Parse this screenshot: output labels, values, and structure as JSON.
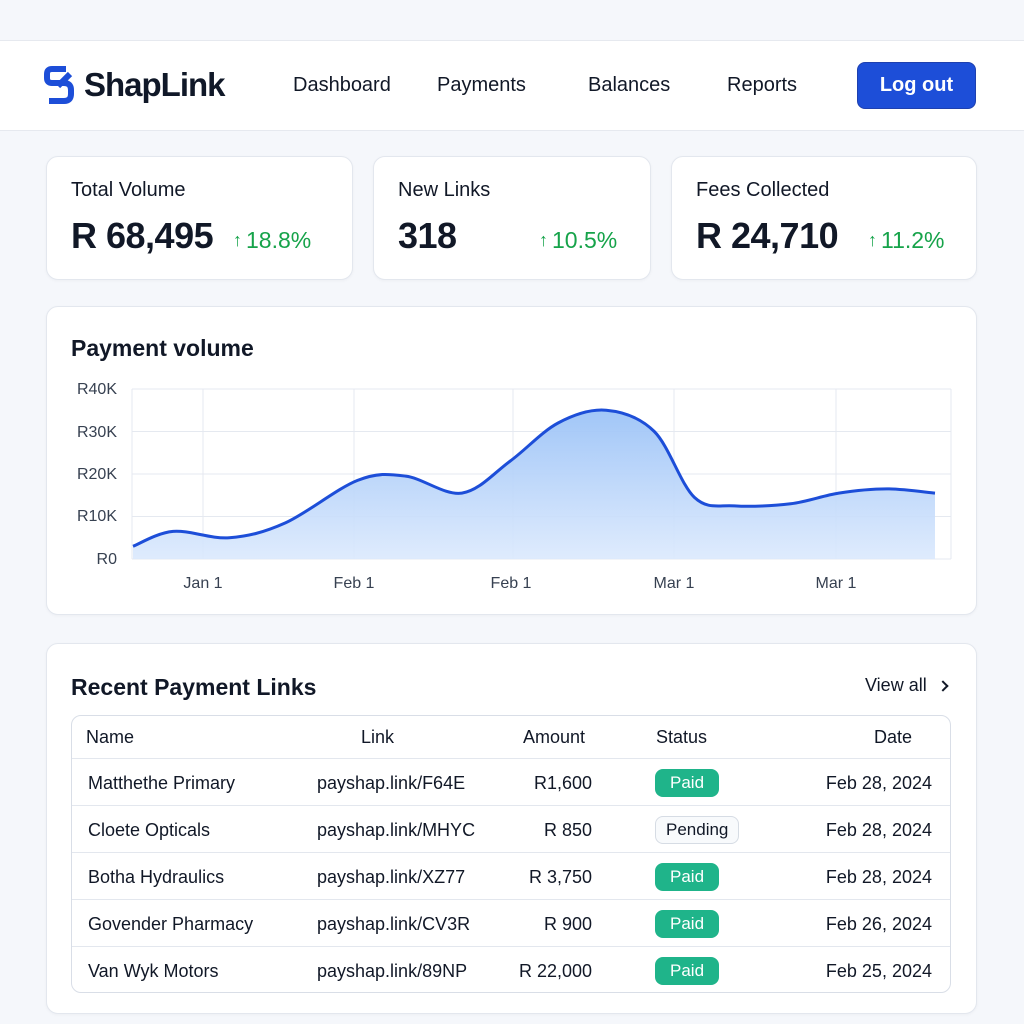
{
  "app": {
    "name": "ShapLink",
    "logo_icon": "shaplink-logo-icon",
    "accent_color": "#1d4ed8",
    "success_color": "#16a34a"
  },
  "nav": {
    "items": [
      {
        "label": "Dashboard"
      },
      {
        "label": "Payments"
      },
      {
        "label": "Balances"
      },
      {
        "label": "Reports"
      }
    ],
    "logout_label": "Log out"
  },
  "stats": [
    {
      "label": "Total Volume",
      "value": "R 68,495",
      "change": "18.8%",
      "trend": "up"
    },
    {
      "label": "New Links",
      "value": "318",
      "change": "10.5%",
      "trend": "up"
    },
    {
      "label": "Fees Collected",
      "value": "R 24,710",
      "change": "11.2%",
      "trend": "up"
    }
  ],
  "chart": {
    "title": "Payment volume",
    "y_ticks": [
      "R40K",
      "R30K",
      "R20K",
      "R10K",
      "R0"
    ],
    "x_ticks": [
      "Jan 1",
      "Feb 1",
      "Feb 1",
      "Mar 1",
      "Mar 1"
    ]
  },
  "chart_data": {
    "type": "area",
    "title": "Payment volume",
    "xlabel": "",
    "ylabel": "",
    "ylim": [
      0,
      40000
    ],
    "grid": true,
    "x_tick_labels": [
      "Jan 1",
      "Feb 1",
      "Feb 1",
      "Mar 1",
      "Mar 1"
    ],
    "series": [
      {
        "color": "#1d4ed8",
        "fill": "#bcd6fb",
        "x": [
          0.0,
          0.05,
          0.12,
          0.19,
          0.28,
          0.34,
          0.41,
          0.47,
          0.53,
          0.59,
          0.65,
          0.7,
          0.75,
          0.82,
          0.88,
          0.94,
          1.0
        ],
        "values": [
          3000,
          6500,
          5000,
          8500,
          18500,
          19500,
          15500,
          23000,
          32000,
          35000,
          30000,
          14500,
          12500,
          13000,
          15500,
          16500,
          15500
        ]
      }
    ]
  },
  "recent": {
    "title": "Recent Payment Links",
    "view_all_label": "View all",
    "columns": [
      "Name",
      "Link",
      "Amount",
      "Status",
      "Date"
    ],
    "rows": [
      {
        "name": "Matthethe Primary",
        "link": "payshap.link/F64E",
        "amount": "R1,600",
        "status": "Paid",
        "date": "Feb 28, 2024"
      },
      {
        "name": "Cloete Opticals",
        "link": "payshap.link/MHYC",
        "amount": "R 850",
        "status": "Pending",
        "date": "Feb 28, 2024"
      },
      {
        "name": "Botha Hydraulics",
        "link": "payshap.link/XZ77",
        "amount": "R 3,750",
        "status": "Paid",
        "date": "Feb 28, 2024"
      },
      {
        "name": "Govender Pharmacy",
        "link": "payshap.link/CV3R",
        "amount": "R 900",
        "status": "Paid",
        "date": "Feb 26, 2024"
      },
      {
        "name": "Van Wyk Motors",
        "link": "payshap.link/89NP",
        "amount": "R 22,000",
        "status": "Paid",
        "date": "Feb 25, 2024"
      }
    ]
  }
}
